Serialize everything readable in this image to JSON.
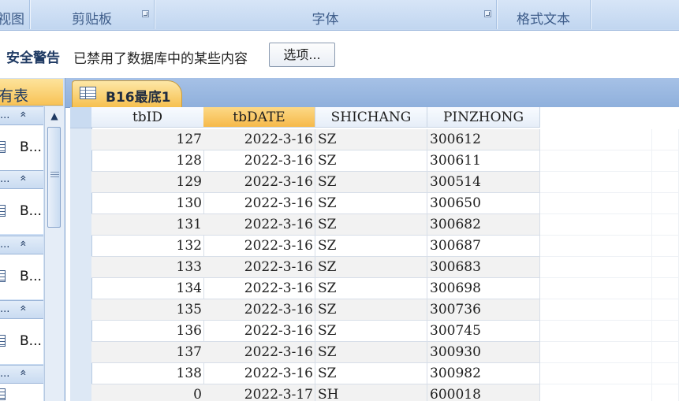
{
  "ribbon": {
    "groups": [
      {
        "label": "视图",
        "launcher": false
      },
      {
        "label": "剪贴板",
        "launcher": true
      },
      {
        "label": "字体",
        "launcher": true
      },
      {
        "label": "格式文本",
        "launcher": false
      },
      {
        "label": "",
        "launcher": false
      }
    ]
  },
  "security_bar": {
    "title": "安全警告",
    "message": "已禁用了数据库中的某些内容",
    "options_button": "选项..."
  },
  "nav_pane": {
    "header": "有表",
    "group_label": "...",
    "group_chevron": "»",
    "item_label": "B...",
    "scroll_up": "▲"
  },
  "document_tab": {
    "title": "B16最底1",
    "icon": "table-icon"
  },
  "grid": {
    "columns": [
      "tbID",
      "tbDATE",
      "SHICHANG",
      "PINZHONG"
    ],
    "selected_column": 1,
    "rows": [
      [
        "127",
        "2022-3-16",
        "SZ",
        "300612"
      ],
      [
        "128",
        "2022-3-16",
        "SZ",
        "300611"
      ],
      [
        "129",
        "2022-3-16",
        "SZ",
        "300514"
      ],
      [
        "130",
        "2022-3-16",
        "SZ",
        "300650"
      ],
      [
        "131",
        "2022-3-16",
        "SZ",
        "300682"
      ],
      [
        "132",
        "2022-3-16",
        "SZ",
        "300687"
      ],
      [
        "133",
        "2022-3-16",
        "SZ",
        "300683"
      ],
      [
        "134",
        "2022-3-16",
        "SZ",
        "300698"
      ],
      [
        "135",
        "2022-3-16",
        "SZ",
        "300736"
      ],
      [
        "136",
        "2022-3-16",
        "SZ",
        "300745"
      ],
      [
        "137",
        "2022-3-16",
        "SZ",
        "300930"
      ],
      [
        "138",
        "2022-3-16",
        "SZ",
        "300982"
      ],
      [
        "0",
        "2022-3-17",
        "SH",
        "600018"
      ]
    ]
  },
  "colors": {
    "accent_orange": "#f6b94a",
    "ribbon_blue": "#c6d9f1",
    "text_dark": "#1f3a63"
  }
}
